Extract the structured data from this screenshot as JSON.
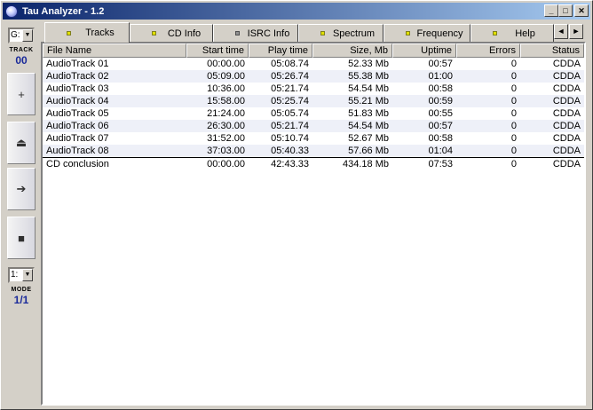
{
  "window": {
    "title": "Tau Analyzer - 1.2",
    "min": "_",
    "max": "□",
    "close": "✕"
  },
  "left": {
    "drive": "G:",
    "track_label": "TRACK",
    "track_value": "00",
    "buttons": [
      "+",
      "⏏",
      "➔",
      "■"
    ],
    "mode_select": "1:",
    "mode_label": "MODE",
    "mode_value": "1/1"
  },
  "tabs": [
    {
      "label": "Tracks",
      "led": "yellow"
    },
    {
      "label": "CD Info",
      "led": "yellow"
    },
    {
      "label": "ISRC Info",
      "led": "gray"
    },
    {
      "label": "Spectrum",
      "led": "yellow"
    },
    {
      "label": "Frequency",
      "led": "yellow"
    },
    {
      "label": "Help",
      "led": "yellow"
    }
  ],
  "tab_scroll": {
    "left": "◄",
    "right": "►"
  },
  "columns": [
    "File Name",
    "Start time",
    "Play time",
    "Size, Mb",
    "Uptime",
    "Errors",
    "Status"
  ],
  "rows": [
    [
      "AudioTrack 01",
      "00:00.00",
      "05:08.74",
      "52.33 Mb",
      "00:57",
      "0",
      "CDDA"
    ],
    [
      "AudioTrack 02",
      "05:09.00",
      "05:26.74",
      "55.38 Mb",
      "01:00",
      "0",
      "CDDA"
    ],
    [
      "AudioTrack 03",
      "10:36.00",
      "05:21.74",
      "54.54 Mb",
      "00:58",
      "0",
      "CDDA"
    ],
    [
      "AudioTrack 04",
      "15:58.00",
      "05:25.74",
      "55.21 Mb",
      "00:59",
      "0",
      "CDDA"
    ],
    [
      "AudioTrack 05",
      "21:24.00",
      "05:05.74",
      "51.83 Mb",
      "00:55",
      "0",
      "CDDA"
    ],
    [
      "AudioTrack 06",
      "26:30.00",
      "05:21.74",
      "54.54 Mb",
      "00:57",
      "0",
      "CDDA"
    ],
    [
      "AudioTrack 07",
      "31:52.00",
      "05:10.74",
      "52.67 Mb",
      "00:58",
      "0",
      "CDDA"
    ],
    [
      "AudioTrack 08",
      "37:03.00",
      "05:40.33",
      "57.66 Mb",
      "01:04",
      "0",
      "CDDA"
    ]
  ],
  "total": [
    "CD conclusion",
    "00:00.00",
    "42:43.33",
    "434.18 Mb",
    "07:53",
    "0",
    "CDDA"
  ]
}
